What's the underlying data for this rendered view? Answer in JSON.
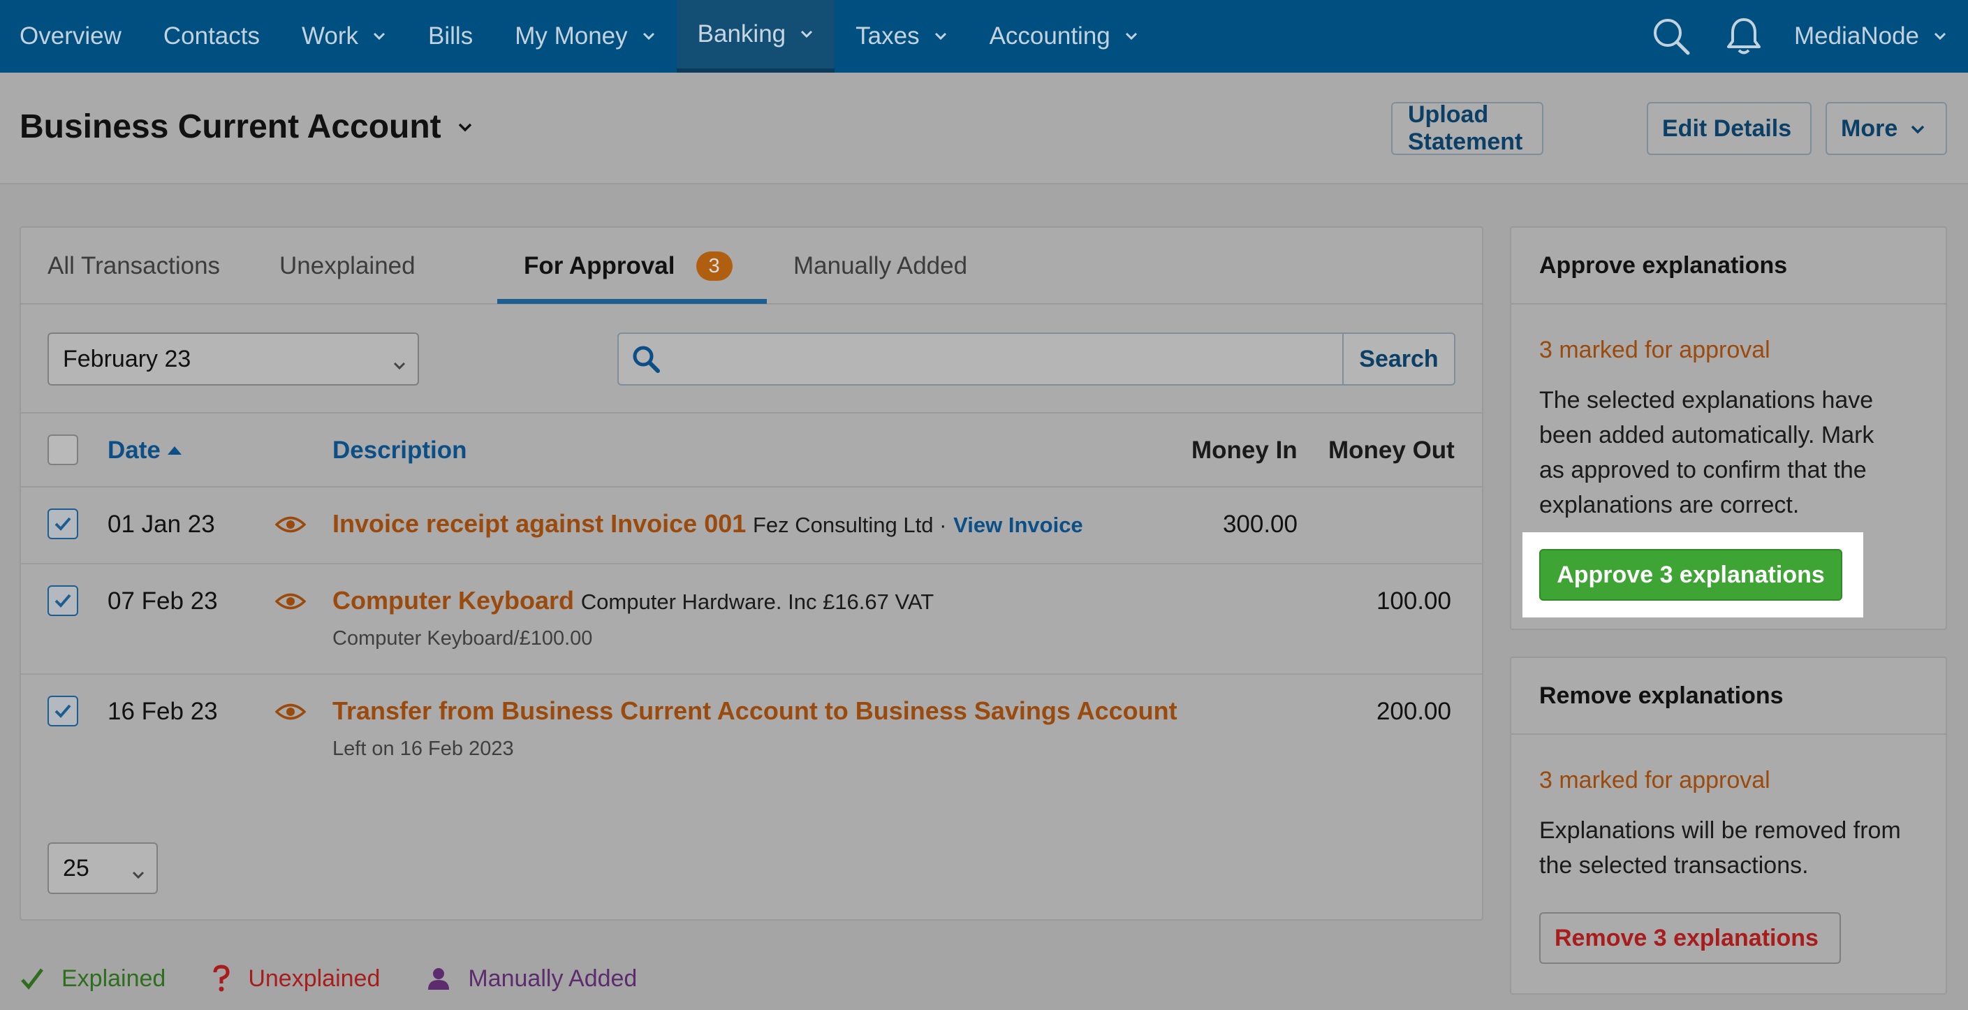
{
  "nav": {
    "items": [
      {
        "label": "Overview",
        "dropdown": false
      },
      {
        "label": "Contacts",
        "dropdown": false
      },
      {
        "label": "Work",
        "dropdown": true
      },
      {
        "label": "Bills",
        "dropdown": false
      },
      {
        "label": "My Money",
        "dropdown": true
      },
      {
        "label": "Banking",
        "dropdown": true,
        "active": true
      },
      {
        "label": "Taxes",
        "dropdown": true
      },
      {
        "label": "Accounting",
        "dropdown": true
      }
    ],
    "user": "MediaNode",
    "icons": [
      "search-icon",
      "bell-icon"
    ]
  },
  "header": {
    "title": "Business Current Account",
    "upload_label": "Upload Statement",
    "edit_label": "Edit Details",
    "more_label": "More"
  },
  "tabs": {
    "all": "All Transactions",
    "unexplained": "Unexplained",
    "for_approval": "For Approval",
    "for_approval_count": "3",
    "manual": "Manually Added"
  },
  "filters": {
    "month": "February 23",
    "search_placeholder": "",
    "search_button": "Search",
    "per_page": "25"
  },
  "table": {
    "headers": {
      "date": "Date",
      "description": "Description",
      "money_in": "Money In",
      "money_out": "Money Out"
    },
    "rows": [
      {
        "checked": true,
        "date": "01 Jan 23",
        "title": "Invoice receipt against Invoice 001",
        "meta": "Fez Consulting Ltd ·",
        "link": "View Invoice",
        "subline": "",
        "money_in": "300.00",
        "money_out": ""
      },
      {
        "checked": true,
        "date": "07 Feb 23",
        "title": "Computer Keyboard",
        "meta": "Computer Hardware. Inc £16.67 VAT",
        "link": "",
        "subline": "Computer Keyboard/£100.00",
        "money_in": "",
        "money_out": "100.00"
      },
      {
        "checked": true,
        "date": "16 Feb 23",
        "title": "Transfer from Business Current Account to Business Savings Account",
        "meta": "",
        "link": "",
        "subline": "Left on 16 Feb 2023",
        "money_in": "",
        "money_out": "200.00"
      }
    ]
  },
  "approve_panel": {
    "title": "Approve explanations",
    "warning": "3 marked for approval",
    "text_lines": [
      "The selected explanations have",
      "been added automatically. Mark",
      "as approved to confirm that the",
      "explanations are correct."
    ],
    "button": "Approve 3 explanations"
  },
  "remove_panel": {
    "title": "Remove explanations",
    "warning": "3 marked for approval",
    "text_lines": [
      "Explanations will be removed from",
      "the selected transactions."
    ],
    "button": "Remove 3 explanations"
  },
  "legend": {
    "explained": "Explained",
    "unexplained": "Unexplained",
    "manual": "Manually Added"
  },
  "colors": {
    "nav_bg": "#004f81",
    "accent_blue": "#0c4f86",
    "orange": "#9a4a0c",
    "approve_green": "#3ea535",
    "remove_red": "#a81c1c",
    "explained_green": "#2e6e1e",
    "unexplained_red": "#a81c1c",
    "manual_purple": "#5c2c6e"
  }
}
